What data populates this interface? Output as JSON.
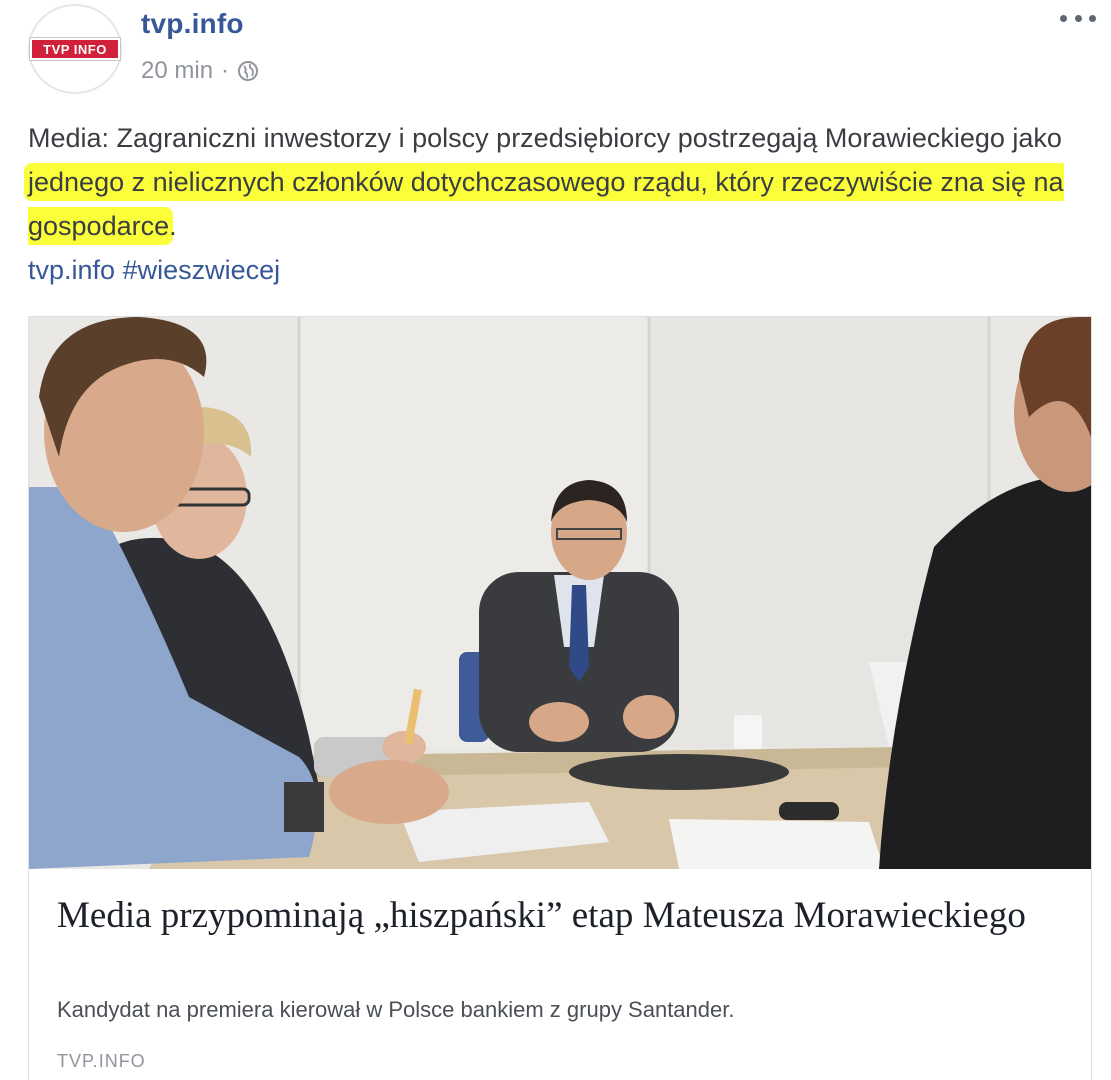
{
  "header": {
    "avatar_logo": "TVP INFO",
    "page_name": "tvp.info",
    "timestamp": "20 min",
    "separator": "·",
    "privacy_icon": "globe-icon",
    "more_icon": "more-options-icon"
  },
  "post": {
    "text_part1": "Media: Zagraniczni inwestorzy i polscy przedsiębiorcy postrzegają Morawieckiego jako ",
    "text_highlighted": "jednego z nielicznych członków dotychczasowego rządu, który rzeczywiście zna się na gospodarce",
    "text_part2": ".",
    "link_text": "tvp.info",
    "hashtag": "#wieszwiecej",
    "highlight_color": "#fbff3a"
  },
  "card": {
    "title": "Media przypominają „hiszpański” etap Mateusza Morawieckiego",
    "description": "Kandydat na premiera kierował w Polsce bankiem z grupy Santander.",
    "domain": "TVP.INFO"
  },
  "colors": {
    "link": "#365899",
    "meta": "#90949c",
    "brand_red": "#d1203a"
  }
}
